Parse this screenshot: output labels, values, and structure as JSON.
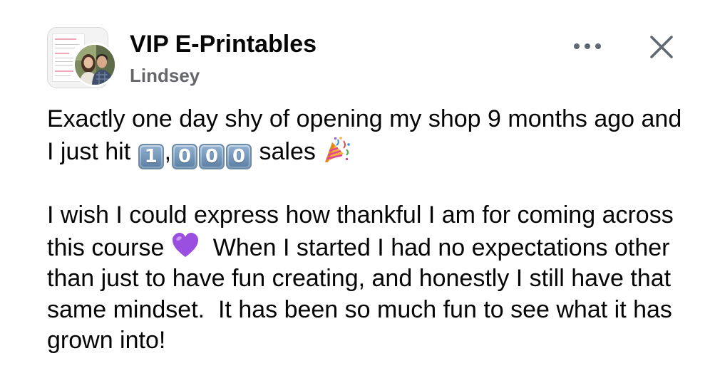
{
  "header": {
    "group_name": "VIP E-Printables",
    "author_name": "Lindsey",
    "more_icon": "more-horizontal-icon",
    "close_icon": "close-icon"
  },
  "post": {
    "line1_text": "Exactly one day shy of opening my shop 9 months ago and I just hit ",
    "keycap_digits": [
      "1",
      "0",
      "0",
      "0"
    ],
    "comma": ",",
    "sales_text": " sales ",
    "party_emoji": "party-popper-icon",
    "para2_part1": "I wish I could express how thankful I am for coming across this course ",
    "heart_emoji": "purple-heart-icon",
    "para2_part2": "  When I started I had no expectations other than just to have fun creating, and honestly I still have that same mindset.  It has been so much fun to see what it has grown into!"
  },
  "colors": {
    "text": "#050505",
    "secondary_text": "#65676b",
    "icon": "#606770",
    "heart": "#9b4fe0"
  }
}
